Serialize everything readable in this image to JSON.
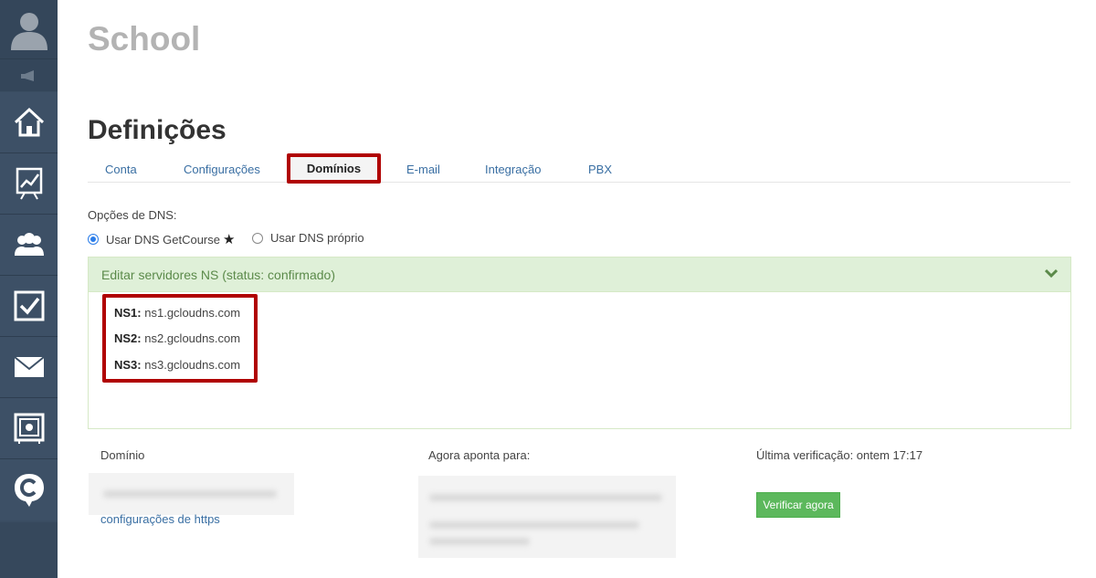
{
  "header": {
    "app_title": "School",
    "page_title": "Definições"
  },
  "tabs": [
    {
      "label": "Conta"
    },
    {
      "label": "Configurações"
    },
    {
      "label": "Domínios",
      "active": true
    },
    {
      "label": "E-mail"
    },
    {
      "label": "Integração"
    },
    {
      "label": "PBX"
    }
  ],
  "dns": {
    "options_label": "Opções de DNS:",
    "option_getcourse": "Usar DNS GetCourse",
    "option_own": "Usar DNS próprio",
    "selected": "getcourse"
  },
  "panel": {
    "title": "Editar servidores NS (status: confirmado)",
    "ns": [
      {
        "key": "NS1:",
        "value": "ns1.gcloudns.com"
      },
      {
        "key": "NS2:",
        "value": "ns2.gcloudns.com"
      },
      {
        "key": "NS3:",
        "value": "ns3.gcloudns.com"
      }
    ]
  },
  "domain_table": {
    "col_domain": "Domínio",
    "col_points_to": "Agora aponta para:",
    "col_last_check": "Última verificação: ontem 17:17",
    "https_link": "configurações de https",
    "verify_button": "Verificar agora"
  },
  "colors": {
    "sidebar_bg": "#3a4d62",
    "link": "#3a6fa3",
    "highlight_border": "#b00000",
    "panel_header_bg": "#dff0d8",
    "verify_button_bg": "#5cb85c"
  },
  "sidebar_icons": [
    "user-avatar-icon",
    "megaphone-icon",
    "home-icon",
    "chart-icon",
    "users-icon",
    "checkbox-icon",
    "mail-icon",
    "safe-icon",
    "getcourse-logo-icon"
  ]
}
